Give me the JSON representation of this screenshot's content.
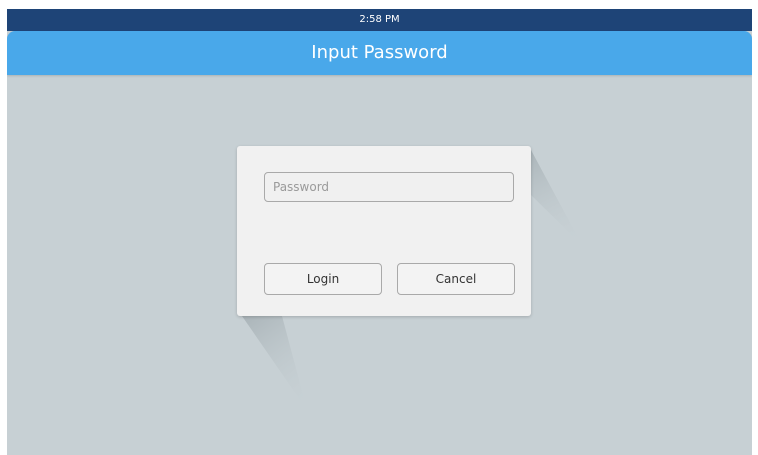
{
  "status_bar": {
    "time": "2:58 PM"
  },
  "header": {
    "title": "Input Password"
  },
  "dialog": {
    "password_placeholder": "Password",
    "password_value": "",
    "login_label": "Login",
    "cancel_label": "Cancel"
  },
  "colors": {
    "status_bar_bg": "#1e4477",
    "header_bg": "#49a8ea",
    "background": "#c7d0d4",
    "dialog_bg": "#f1f1f1"
  }
}
